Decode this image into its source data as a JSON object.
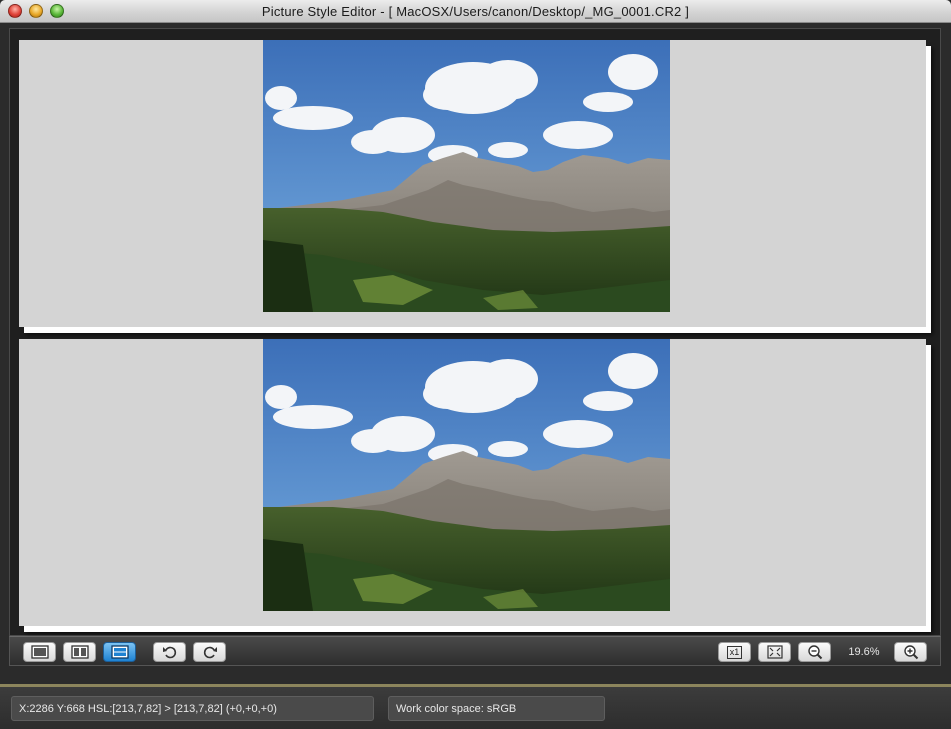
{
  "window": {
    "title": "Picture Style Editor - [ MacOSX/Users/canon/Desktop/_MG_0001.CR2 ]"
  },
  "viewer": {
    "panels": [
      {
        "name": "top-preview",
        "content": "photo"
      },
      {
        "name": "bottom-preview",
        "content": "photo"
      }
    ]
  },
  "toolbar": {
    "left_buttons": [
      "single-view-icon",
      "side-by-side-view-icon",
      "top-bottom-view-icon",
      "rotate-left-icon",
      "rotate-right-icon"
    ],
    "active_view": "top-bottom-view-icon",
    "right_buttons": [
      "actual-size-icon",
      "fit-to-window-icon",
      "zoom-out-icon",
      "zoom-in-icon"
    ],
    "actual_size_label": "x1",
    "zoom_level": "19.6%"
  },
  "status": {
    "cursor_info": "X:2286 Y:668  HSL:[213,7,82] > [213,7,82]  (+0,+0,+0)",
    "color_space": "Work color space: sRGB"
  },
  "colors": {
    "active_button": "#1e82d2",
    "panel_background": "#d4d4d4",
    "separator": "#8c855c"
  }
}
